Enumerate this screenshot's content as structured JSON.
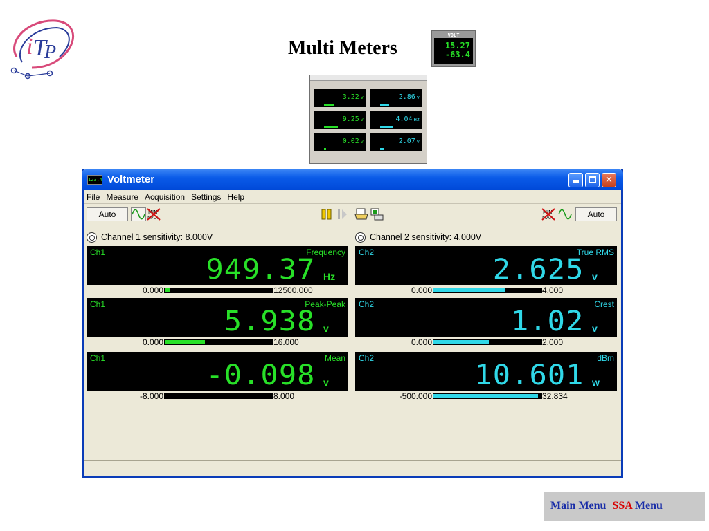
{
  "page": {
    "title": "Multi Meters",
    "title_icon_label": "VOLT",
    "title_icon_values": [
      "15.27",
      "-63.4"
    ]
  },
  "thumbnail": {
    "cells": [
      {
        "value": "3.22",
        "unit": "v",
        "color": "green",
        "fill": 0.3
      },
      {
        "value": "2.86",
        "unit": "v",
        "color": "cyan",
        "fill": 0.25
      },
      {
        "value": "9.25",
        "unit": "v",
        "color": "green",
        "fill": 0.4
      },
      {
        "value": "4.04",
        "unit": "Hz",
        "color": "cyan",
        "fill": 0.35
      },
      {
        "value": "0.02",
        "unit": "v",
        "color": "green",
        "fill": 0.05
      },
      {
        "value": "2.07",
        "unit": "v",
        "color": "cyan",
        "fill": 0.1
      }
    ]
  },
  "window": {
    "title": "Voltmeter",
    "app_icon_text": "123.4",
    "menu": [
      "File",
      "Measure",
      "Acquisition",
      "Settings",
      "Help"
    ],
    "toolbar": {
      "left_auto": "Auto",
      "right_auto": "Auto"
    },
    "channel1_header": "Channel 1 sensitivity: 8.000V",
    "channel2_header": "Channel 2 sensitivity: 4.000V",
    "meters": [
      {
        "channel": "Ch1",
        "function": "Frequency",
        "value": "949.37",
        "unit": "Hz",
        "min": "0.000",
        "max": "12500.000",
        "fill": 0.045
      },
      {
        "channel": "Ch2",
        "function": "True RMS",
        "value": "2.625",
        "unit": "v",
        "min": "0.000",
        "max": "4.000",
        "fill": 0.66
      },
      {
        "channel": "Ch1",
        "function": "Peak-Peak",
        "value": "5.938",
        "unit": "v",
        "min": "0.000",
        "max": "16.000",
        "fill": 0.37
      },
      {
        "channel": "Ch2",
        "function": "Crest",
        "value": "1.02",
        "unit": "v",
        "min": "0.000",
        "max": "2.000",
        "fill": 0.51
      },
      {
        "channel": "Ch1",
        "function": "Mean",
        "value": "-0.098",
        "unit": "v",
        "min": "-8.000",
        "max": "8.000",
        "fill": 0.0
      },
      {
        "channel": "Ch2",
        "function": "dBm",
        "value": "10.601",
        "unit": "w",
        "min": "-500.000",
        "max": "32.834",
        "fill": 0.97
      }
    ]
  },
  "nav": {
    "main_menu": "Main Menu",
    "ssa_prefix": "SSA",
    "ssa_suffix": " Menu"
  },
  "colors": {
    "green": "#28e028",
    "cyan": "#30d8e8",
    "titlebar": "#0a5be8"
  }
}
